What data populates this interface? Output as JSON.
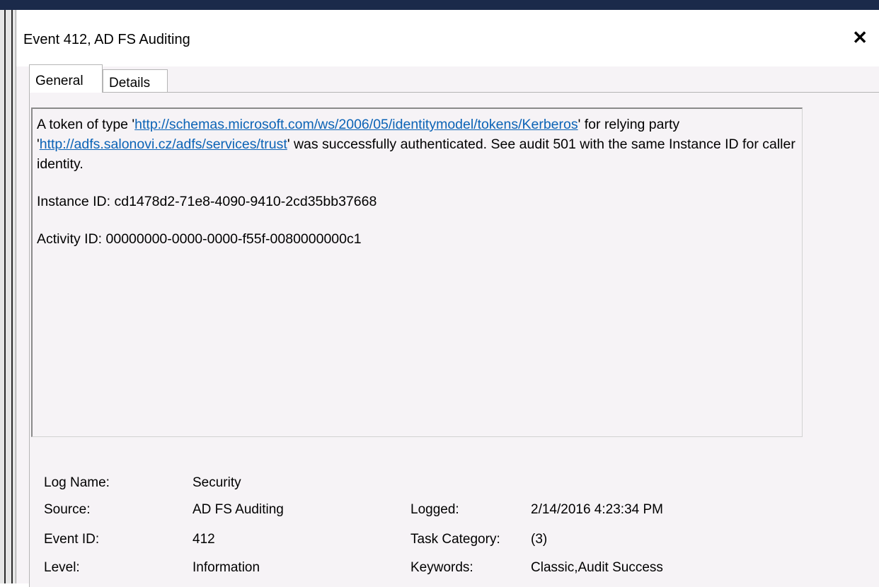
{
  "window": {
    "title": "Event 412, AD FS Auditing",
    "close_glyph": "✕"
  },
  "tabs": [
    {
      "label": "General",
      "selected": true
    },
    {
      "label": "Details",
      "selected": false
    }
  ],
  "description": {
    "text_1": "A token of type '",
    "link_1": "http://schemas.microsoft.com/ws/2006/05/identitymodel/tokens/Kerberos",
    "text_2": "' for relying party '",
    "link_2": "http://adfs.salonovi.cz/adfs/services/trust",
    "text_3": "' was successfully authenticated.  See audit 501 with the same Instance ID for caller identity.",
    "instance_line": "Instance ID: cd1478d2-71e8-4090-9410-2cd35bb37668",
    "activity_line": "Activity ID: 00000000-0000-0000-f55f-0080000000c1"
  },
  "fields": {
    "log_name": {
      "label": "Log Name:",
      "value": "Security"
    },
    "source": {
      "label": "Source:",
      "value": "AD FS Auditing"
    },
    "logged": {
      "label": "Logged:",
      "value": "2/14/2016 4:23:34 PM"
    },
    "event_id": {
      "label": "Event ID:",
      "value": "412"
    },
    "task_category": {
      "label": "Task Category:",
      "value": "(3)"
    },
    "level": {
      "label": "Level:",
      "value": "Information"
    },
    "keywords": {
      "label": "Keywords:",
      "value": "Classic,Audit Success"
    }
  },
  "colors": {
    "link": "#0b63b6",
    "dialog_bg": "#f6f3f6",
    "title_bg": "#ffffff",
    "top_strip": "#1b2a4a"
  }
}
